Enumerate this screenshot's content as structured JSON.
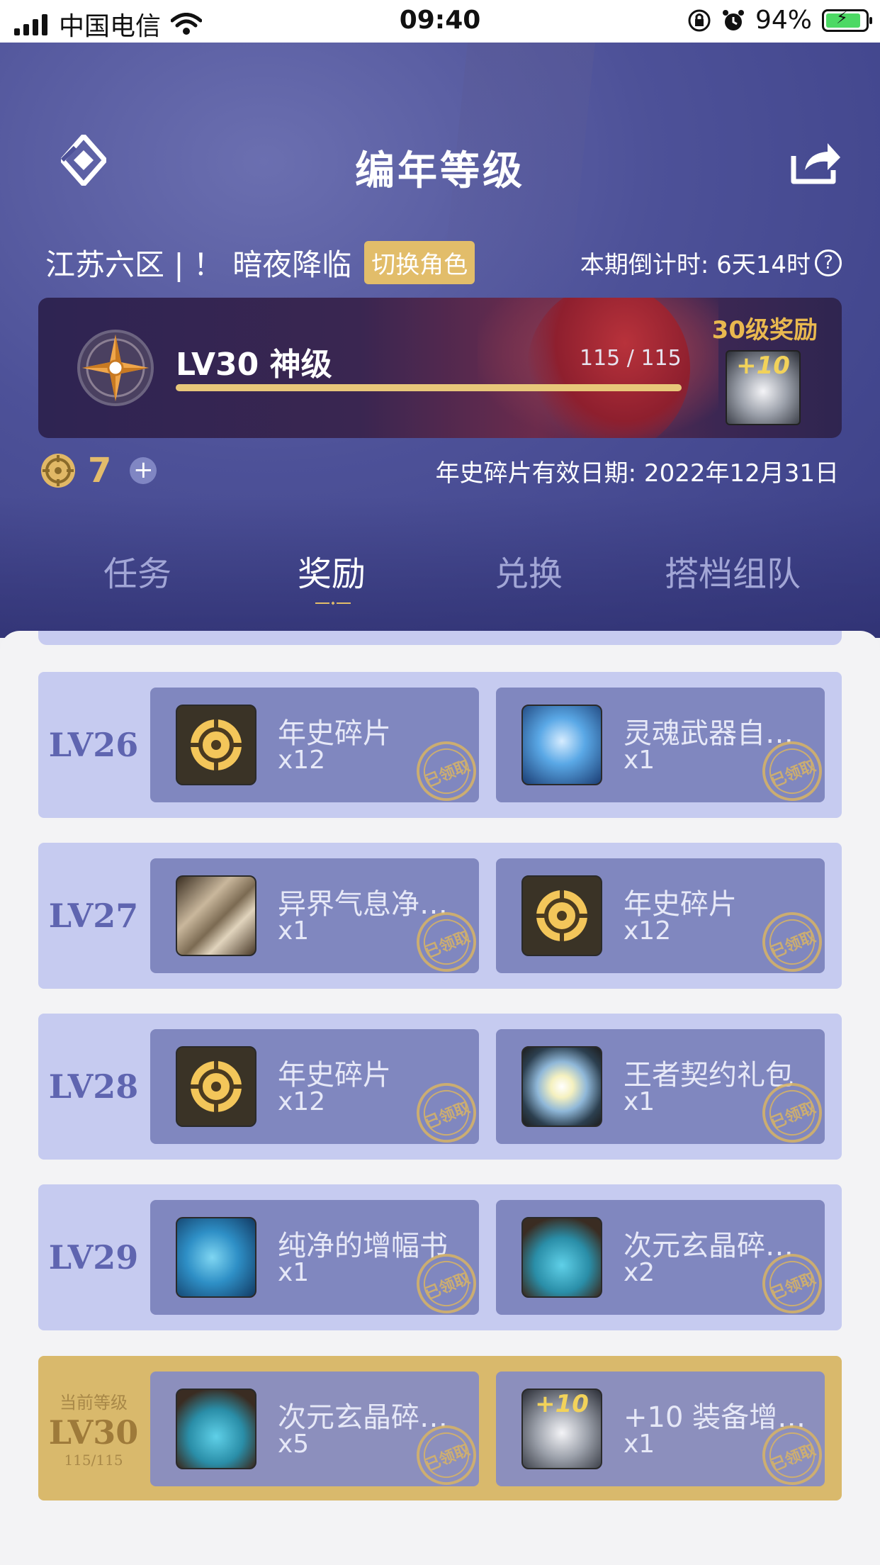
{
  "status_bar": {
    "carrier": "中国电信",
    "time": "09:40",
    "battery": "94%"
  },
  "header": {
    "title": "编年等级"
  },
  "role": {
    "name": "江苏六区 | ！ 暗夜降临",
    "switch_label": "切换角色",
    "countdown": "本期倒计时: 6天14时"
  },
  "level_card": {
    "title": "LV30 神级",
    "progress_text": "115 / 115",
    "progress_fraction": 1.0,
    "reward_label": "30级奖励",
    "reward_item": "+10"
  },
  "currency": {
    "count": "7",
    "expire_text": "年史碎片有效日期: 2022年12月31日"
  },
  "tabs": [
    {
      "label": "任务",
      "active": false
    },
    {
      "label": "奖励",
      "active": true
    },
    {
      "label": "兑换",
      "active": false
    },
    {
      "label": "搭档组队",
      "active": false
    }
  ],
  "stamp_text": "已领取",
  "rows": [
    {
      "level": "LV26",
      "items": [
        {
          "name": "年史碎片",
          "qty": "x12",
          "icon": "coin-icon"
        },
        {
          "name": "灵魂武器自…",
          "qty": "x1",
          "icon": "chest-icon"
        }
      ]
    },
    {
      "level": "LV27",
      "items": [
        {
          "name": "异界气息净…",
          "qty": "x1",
          "icon": "scroll-icon"
        },
        {
          "name": "年史碎片",
          "qty": "x12",
          "icon": "coin-icon"
        }
      ]
    },
    {
      "level": "LV28",
      "items": [
        {
          "name": "年史碎片",
          "qty": "x12",
          "icon": "coin-icon"
        },
        {
          "name": "王者契约礼包",
          "qty": "x1",
          "icon": "burst-icon"
        }
      ]
    },
    {
      "level": "LV29",
      "items": [
        {
          "name": "纯净的增幅书",
          "qty": "x1",
          "icon": "book-icon"
        },
        {
          "name": "次元玄晶碎…",
          "qty": "x2",
          "icon": "pouch-icon"
        }
      ]
    },
    {
      "level": "LV30",
      "current_tag": "当前等级",
      "progress": "115/115",
      "items": [
        {
          "name": "次元玄晶碎…",
          "qty": "x5",
          "icon": "pouch-icon"
        },
        {
          "name": "+10 装备增…",
          "qty": "x1",
          "icon": "plus10-icon"
        }
      ]
    }
  ],
  "colors": {
    "accent_gold": "#e2bd6a",
    "hero_blue": "#4d5198",
    "row_bg": "#c6cbf0",
    "cell_bg": "#8087bf",
    "current_row_bg": "#d9b96c"
  }
}
